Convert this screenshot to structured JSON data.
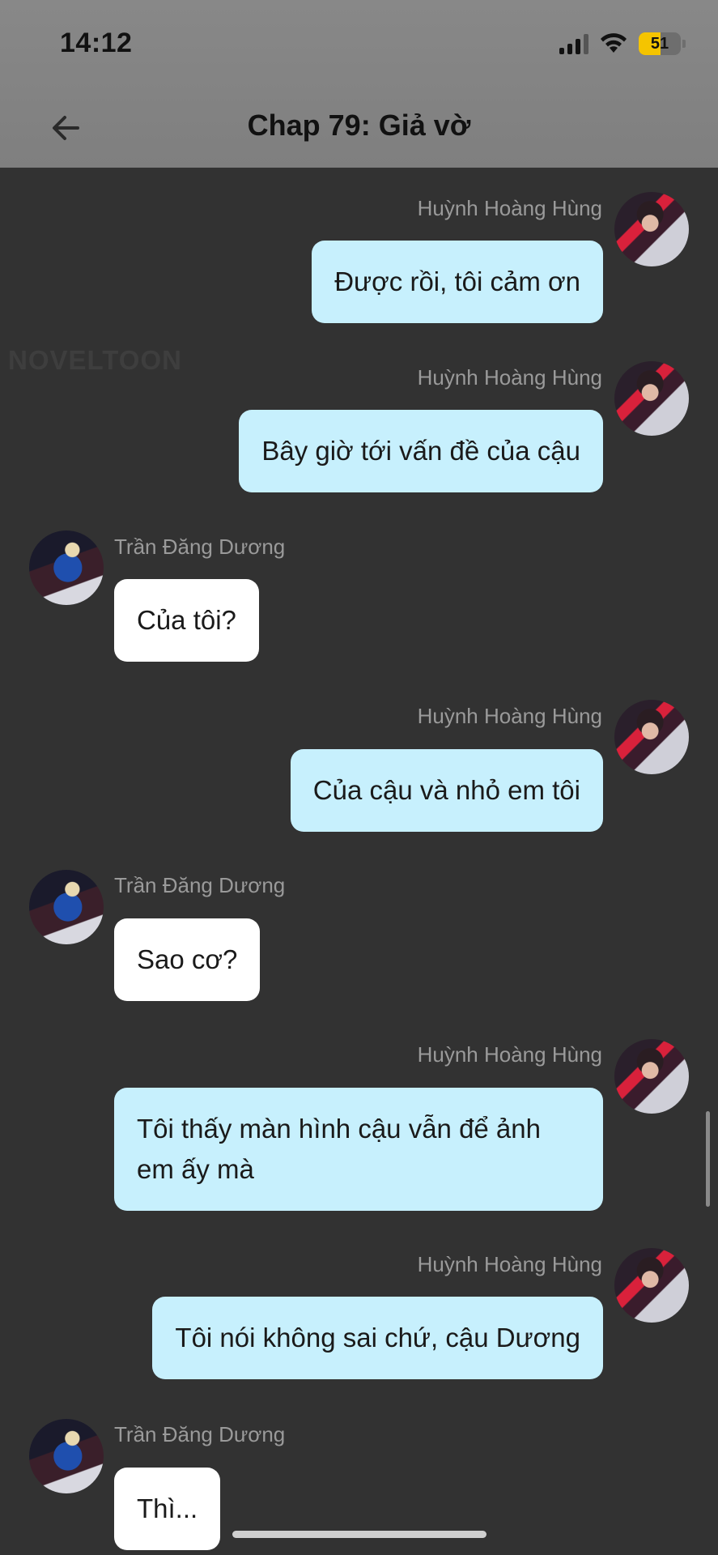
{
  "status_bar": {
    "time": "14:12",
    "battery": "51",
    "battery_level": 0.51
  },
  "header": {
    "title": "Chap 79: Giả vờ",
    "back_icon": "arrow-left-icon"
  },
  "watermark": "NOVELTOON",
  "messages": [
    {
      "side": "right",
      "sender": "Huỳnh Hoàng Hùng",
      "text": "Được rồi, tôi cảm ơn"
    },
    {
      "side": "right",
      "sender": "Huỳnh Hoàng Hùng",
      "text": "Bây giờ tới vấn đề của cậu"
    },
    {
      "side": "left",
      "sender": "Trần Đăng Dương",
      "text": "Của tôi?"
    },
    {
      "side": "right",
      "sender": "Huỳnh Hoàng Hùng",
      "text": "Của cậu và nhỏ em tôi"
    },
    {
      "side": "left",
      "sender": "Trần Đăng Dương",
      "text": "Sao cơ?"
    },
    {
      "side": "right",
      "sender": "Huỳnh Hoàng Hùng",
      "text": "Tôi thấy màn hình cậu vẫn để ảnh em ấy mà"
    },
    {
      "side": "right",
      "sender": "Huỳnh Hoàng Hùng",
      "text": "Tôi nói không sai chứ, cậu Dương"
    },
    {
      "side": "left",
      "sender": "Trần Đăng Dương",
      "text": "Thì..."
    }
  ],
  "colors": {
    "background": "#323232",
    "right_bubble": "#c7f0fd",
    "left_bubble": "#ffffff",
    "name": "#9a9a9a",
    "battery": "#f5c400"
  }
}
